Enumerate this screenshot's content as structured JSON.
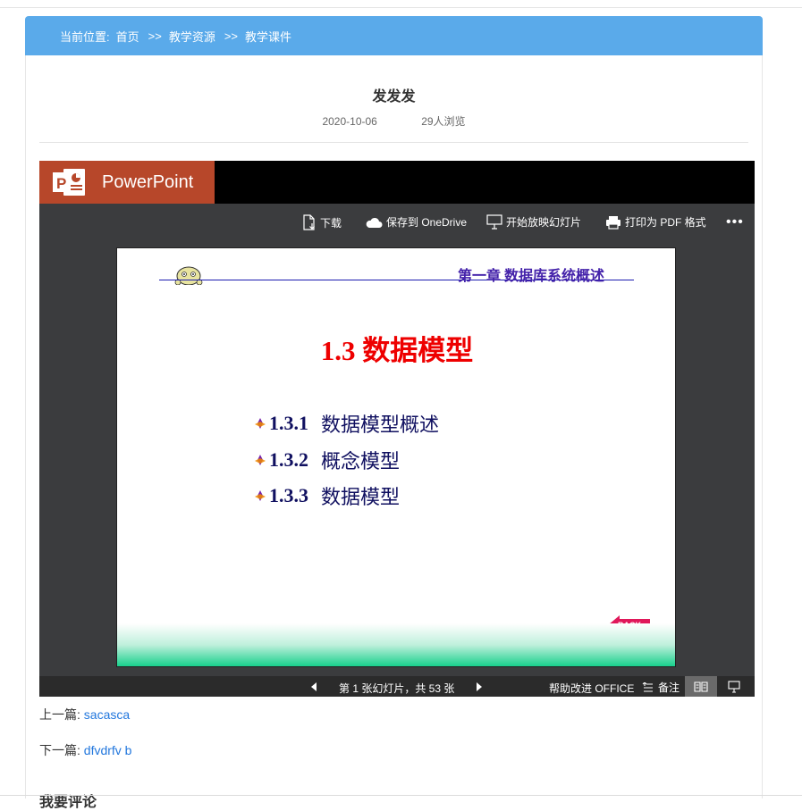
{
  "breadcrumb": {
    "label": "当前位置:",
    "home": "首页",
    "separator": ">>",
    "level1": "教学资源",
    "level2": "教学课件"
  },
  "article": {
    "title": "发发发",
    "date": "2020-10-06",
    "views": "29人浏览"
  },
  "viewer": {
    "brand": "PowerPoint",
    "toolbar": {
      "download": "下载",
      "save_onedrive": "保存到 OneDrive",
      "start_slideshow": "开始放映幻灯片",
      "print_pdf": "打印为 PDF 格式",
      "more": "•••"
    },
    "slide": {
      "chapter": "第一章 数据库系统概述",
      "title": "1.3 数据模型",
      "items": [
        {
          "num": "1.3.1",
          "text": "数据模型概述"
        },
        {
          "num": "1.3.2",
          "text": "概念模型"
        },
        {
          "num": "1.3.3",
          "text": "数据模型"
        }
      ],
      "back_label": "BACK"
    },
    "status": {
      "slide_count": "第 1 张幻灯片，共 53 张",
      "help": "帮助改进 OFFICE",
      "notes": "备注"
    }
  },
  "navigation": {
    "prev_label": "上一篇:",
    "prev_title": "sacasca",
    "next_label": "下一篇:",
    "next_title": "dfvdrfv b"
  },
  "comments": {
    "heading": "我要评论"
  },
  "colors": {
    "header_blue": "#5aaaea",
    "powerpoint_orange": "#b7472a",
    "link_blue": "#2277dd",
    "slide_title_red": "#ee0000"
  }
}
